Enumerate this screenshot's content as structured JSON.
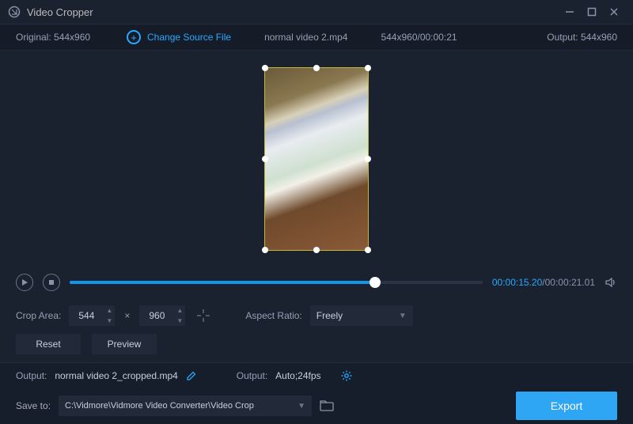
{
  "titlebar": {
    "title": "Video Cropper"
  },
  "infobar": {
    "original_label": "Original:",
    "original_value": "544x960",
    "change_source": "Change Source File",
    "filename": "normal video 2.mp4",
    "meta": "544x960/00:00:21",
    "output_label": "Output:",
    "output_value": "544x960"
  },
  "transport": {
    "current": "00:00:15.20",
    "total": "00:00:21.01"
  },
  "crop": {
    "area_label": "Crop Area:",
    "width": "544",
    "height": "960",
    "aspect_label": "Aspect Ratio:",
    "aspect_value": "Freely"
  },
  "buttons": {
    "reset": "Reset",
    "preview": "Preview",
    "export": "Export"
  },
  "output": {
    "out_label": "Output:",
    "out_file": "normal video 2_cropped.mp4",
    "fmt_label": "Output:",
    "fmt_value": "Auto;24fps"
  },
  "save": {
    "label": "Save to:",
    "path": "C:\\Vidmore\\Vidmore Video Converter\\Video Crop"
  }
}
